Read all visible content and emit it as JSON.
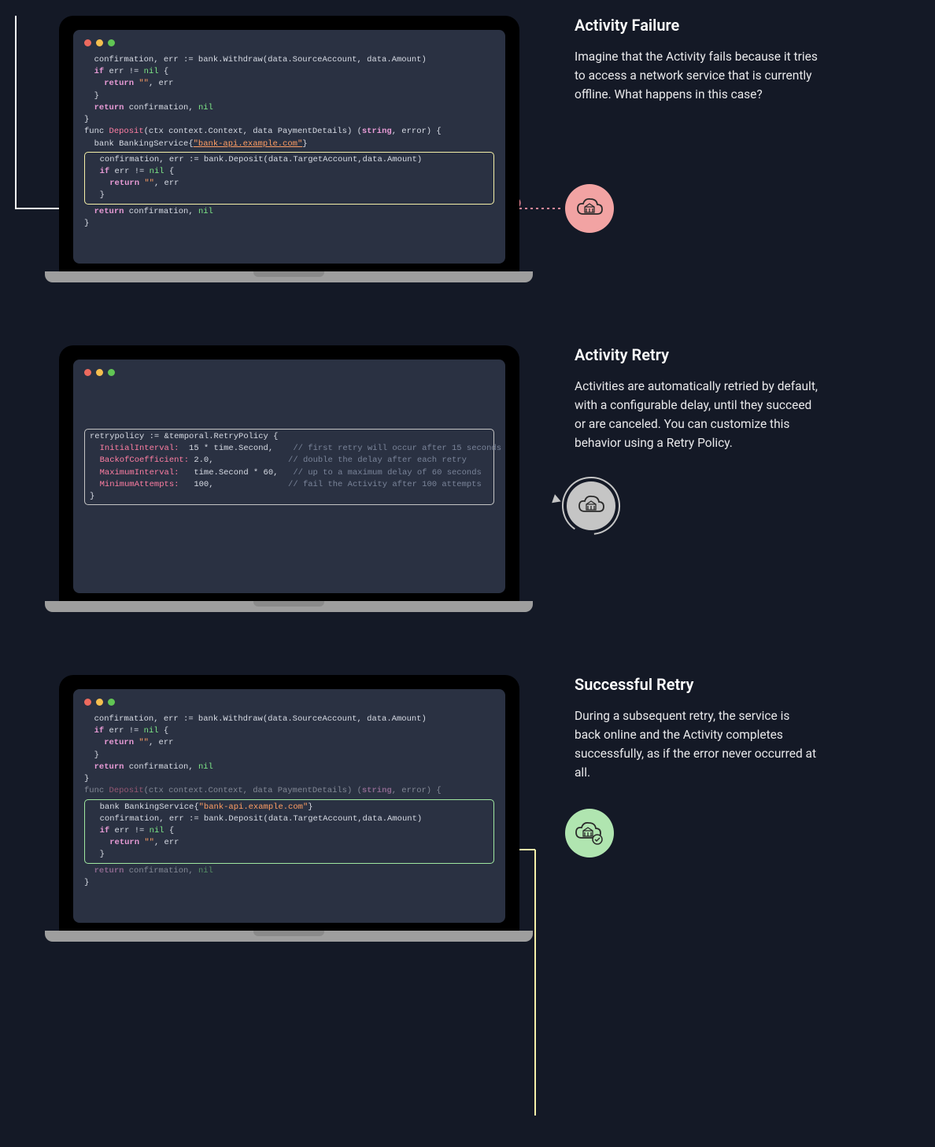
{
  "sections": {
    "failure": {
      "title": "Activity Failure",
      "body": "Imagine that the Activity fails because it tries to access a network service that is currently offline. What happens in this case?"
    },
    "retry": {
      "title": "Activity Retry",
      "body": "Activities are automatically retried by default, with a configurable delay, until they succeed or are canceled. You can customize this behavior using a Retry Policy."
    },
    "success": {
      "title": "Successful Retry",
      "body": "During a subsequent retry, the service is back online and the Activity completes successfully, as if the error never occurred at all."
    }
  },
  "code": {
    "withdraw_line": "  confirmation, err := bank.Withdraw(data.SourceAccount, data.Amount)",
    "if_err": "  if err != ",
    "nil_brace": " {",
    "return_empty": "    return \"\", err",
    "close_brace": "  }",
    "blank": "",
    "return_conf": "  return confirmation, ",
    "close_brace2": "}",
    "func_deposit_1": "func ",
    "func_deposit_name": "Deposit",
    "func_deposit_2": "(ctx context.Context, data PaymentDetails) (",
    "string_t": "string",
    "func_deposit_3": ", error) {",
    "bank_service_prefix": "  bank BankingService{",
    "bank_url": "\"bank-api.example.com\"",
    "bank_service_suffix": "}",
    "deposit_call": "  confirmation, err := bank.Deposit(data.TargetAccount,data.Amount)",
    "retry_policy_header": "retrypolicy := &temporal.RetryPolicy {",
    "rp_initial_k": "  InitialInterval:",
    "rp_initial_v": "  15 * time.Second,",
    "rp_initial_c": "    // first retry will occur after 15 seconds",
    "rp_backoff_k": "  BackofCoefficient:",
    "rp_backoff_v": " 2.0,",
    "rp_backoff_c": "               // double the delay after each retry",
    "rp_max_k": "  MaximumInterval:",
    "rp_max_v": "   time.Second * 60,",
    "rp_max_c": "   // up to a maximum delay of 60 seconds",
    "rp_attempts_k": "  MinimumAttempts:",
    "rp_attempts_v": "   100,",
    "rp_attempts_c": "               // fail the Activity after 100 attempts",
    "rp_close": "}",
    "nil": "nil"
  },
  "icons": {
    "bank": "bank-cloud-icon"
  }
}
